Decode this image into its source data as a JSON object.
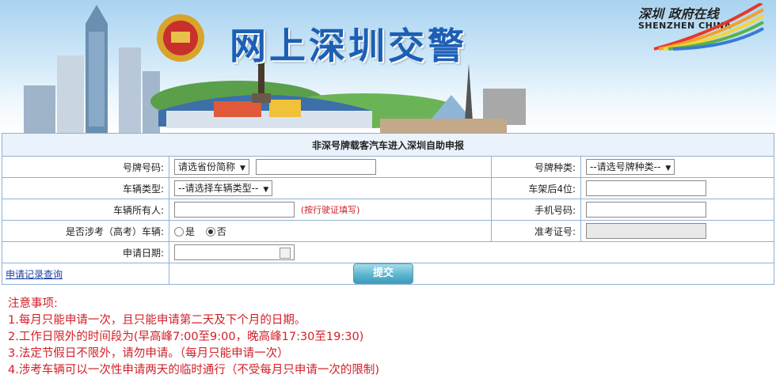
{
  "banner": {
    "title": "网上深圳交警",
    "logo_cn": "深圳 政府在线",
    "logo_en": "SHENZHEN CHINA"
  },
  "form": {
    "heading": "非深号牌载客汽车进入深圳自助申报",
    "plate_label": "号牌号码:",
    "province_placeholder": "请选省份简称",
    "plate_type_label": "号牌种类:",
    "plate_type_placeholder": "--请选号牌种类--",
    "vehicle_type_label": "车辆类型:",
    "vehicle_type_placeholder": "--请选择车辆类型--",
    "frame_label": "车架后4位:",
    "owner_label": "车辆所有人:",
    "owner_hint": "(按行驶证填写)",
    "phone_label": "手机号码:",
    "exam_label": "是否涉考（高考）车辆:",
    "exam_yes": "是",
    "exam_no": "否",
    "exam_selected": "否",
    "ticket_label": "准考证号:",
    "date_label": "申请日期:",
    "records_link": "申请记录查询",
    "submit": "提交"
  },
  "notes": {
    "title": "注意事项:",
    "items": [
      "1.每月只能申请一次，且只能申请第二天及下个月的日期。",
      "2.工作日限外的时间段为(早高峰7:00至9:00，晚高峰17:30至19:30)",
      "3.法定节假日不限外，请勿申请。（每月只能申请一次）",
      "4.涉考车辆可以一次性申请两天的临时通行（不受每月只申请一次的限制)"
    ]
  },
  "colors": {
    "title_blue": "#1c5fb5",
    "note_red": "#d2202a",
    "border": "#8fb2d6"
  }
}
